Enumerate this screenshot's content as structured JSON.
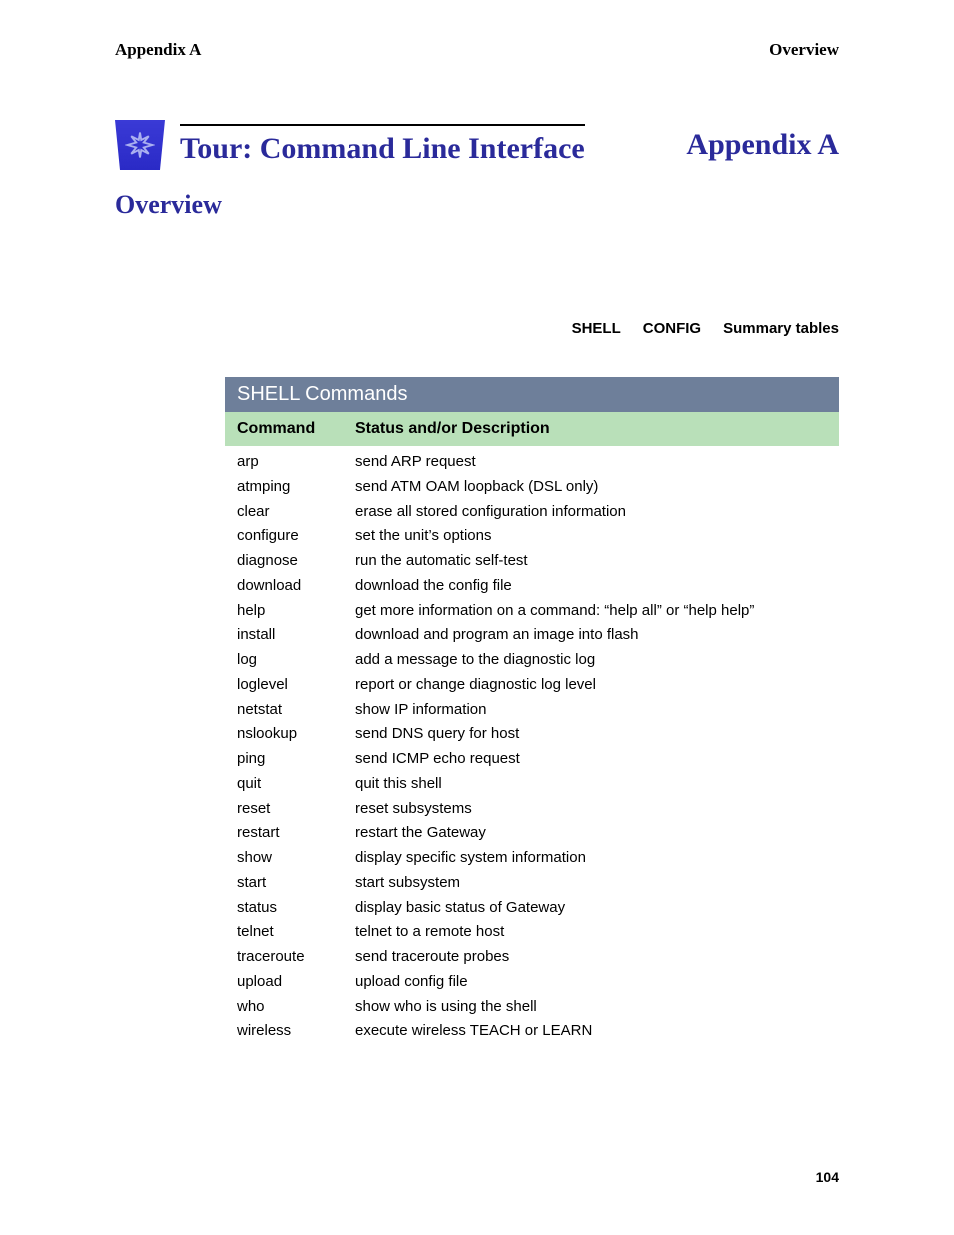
{
  "header": {
    "left": "Appendix A",
    "right": "Overview"
  },
  "title_block": {
    "main_title": "Tour: Command Line Interface",
    "side_title": "Appendix A"
  },
  "overview_heading": "Overview",
  "tabs": {
    "shell": "SHELL",
    "config": "CONFIG",
    "summary": "Summary tables"
  },
  "table": {
    "title": "SHELL Commands",
    "columns": {
      "command": "Command",
      "description": "Status and/or Description"
    },
    "rows": [
      {
        "cmd": "arp",
        "desc": "send ARP request"
      },
      {
        "cmd": "atmping",
        "desc": "send ATM OAM loopback (DSL only)"
      },
      {
        "cmd": "clear",
        "desc": "erase all stored configuration information"
      },
      {
        "cmd": "configure",
        "desc": "set the unit’s options"
      },
      {
        "cmd": "diagnose",
        "desc": "run the automatic self-test"
      },
      {
        "cmd": "download",
        "desc": "download the config file"
      },
      {
        "cmd": "help",
        "desc": "get more information on a command: “help all” or “help help”"
      },
      {
        "cmd": "install",
        "desc": "download and program an image into flash"
      },
      {
        "cmd": "log",
        "desc": "add a message to the diagnostic log"
      },
      {
        "cmd": "loglevel",
        "desc": "report or change diagnostic log level"
      },
      {
        "cmd": "netstat",
        "desc": "show IP information"
      },
      {
        "cmd": "nslookup",
        "desc": "send DNS query for host"
      },
      {
        "cmd": "ping",
        "desc": "send ICMP echo request"
      },
      {
        "cmd": "quit",
        "desc": "quit this shell"
      },
      {
        "cmd": "reset",
        "desc": "reset subsystems"
      },
      {
        "cmd": "restart",
        "desc": "restart the Gateway"
      },
      {
        "cmd": "show",
        "desc": "display specific system information"
      },
      {
        "cmd": "start",
        "desc": "start subsystem"
      },
      {
        "cmd": "status",
        "desc": "display basic status of Gateway"
      },
      {
        "cmd": "telnet",
        "desc": "telnet to a remote host"
      },
      {
        "cmd": "traceroute",
        "desc": "send traceroute probes"
      },
      {
        "cmd": "upload",
        "desc": "upload config file"
      },
      {
        "cmd": "who",
        "desc": "show who is using the shell"
      },
      {
        "cmd": "wireless",
        "desc": "execute wireless TEACH or LEARN"
      }
    ]
  },
  "page_number": "104"
}
